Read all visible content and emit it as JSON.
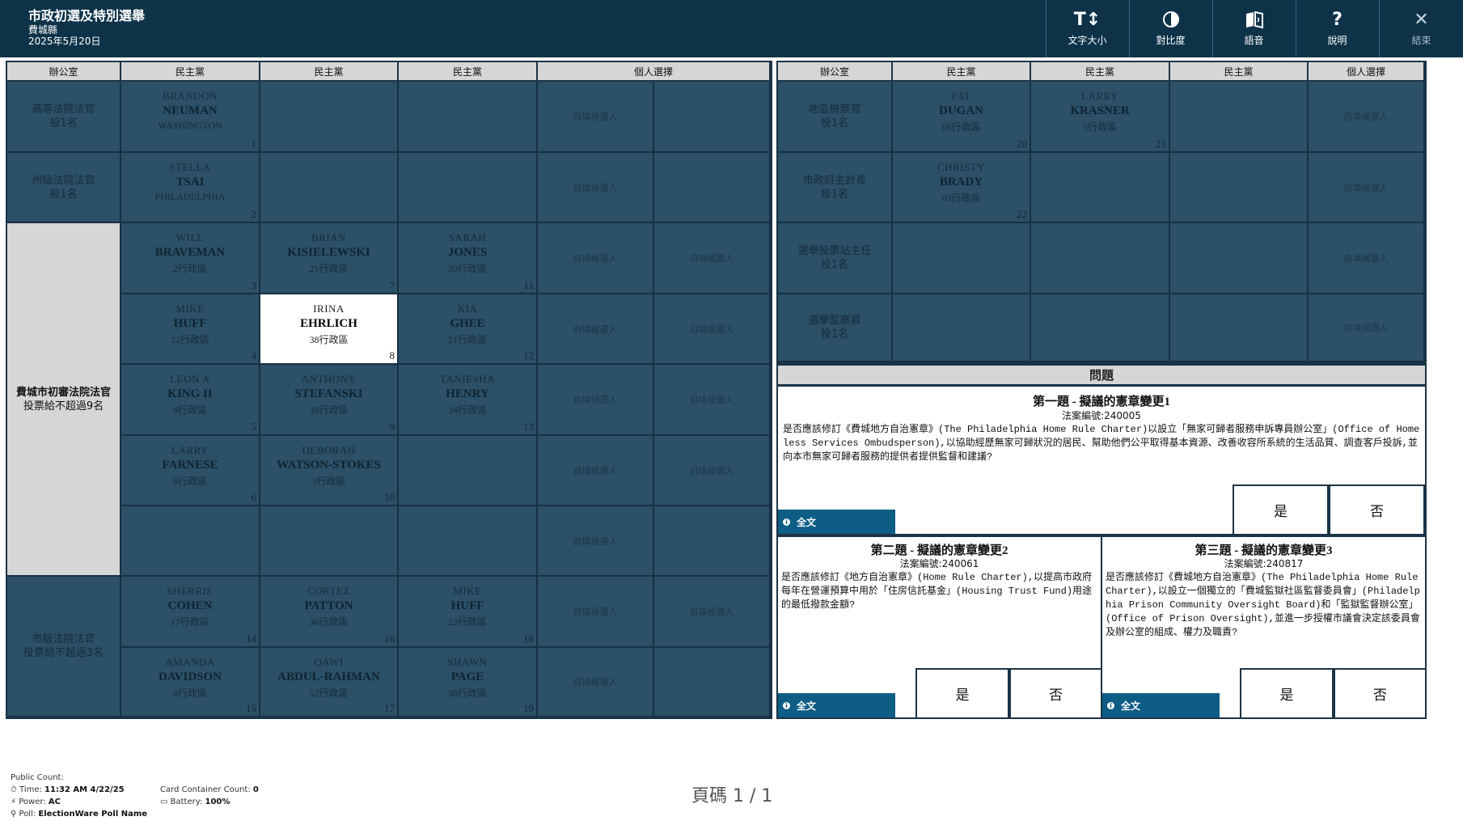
{
  "header": {
    "title": "市政初選及特別選舉",
    "county": "費城縣",
    "date": "2025年5月20日"
  },
  "toolbar": {
    "text_size": "文字大小",
    "contrast": "對比度",
    "audio": "語音",
    "help": "說明",
    "exit": "結束",
    "text_size_glyph": "T↕",
    "help_glyph": "?",
    "exit_glyph": "✕"
  },
  "ballot_headers": {
    "left": [
      "辦公室",
      "民主黨",
      "民主黨",
      "民主黨",
      "個人選擇"
    ],
    "right": [
      "辦公室",
      "民主黨",
      "民主黨",
      "民主黨",
      "個人選擇"
    ]
  },
  "write_in_label": "自填候選人",
  "offices": {
    "superior": {
      "name": "高等法院法官",
      "vote": "投1名"
    },
    "commonwealth": {
      "name": "州級法院法官",
      "vote": "投1名"
    },
    "common_pleas": {
      "name": "費城市初審法院法官",
      "vote": "投票給不超過9名"
    },
    "municipal": {
      "name": "市級法院法官",
      "vote": "投票給不超過3名"
    },
    "da": {
      "name": "地區檢察官",
      "vote": "投1名"
    },
    "controller": {
      "name": "市政府主計長",
      "vote": "投1名"
    },
    "judge_election": {
      "name": "選舉投票站主任",
      "vote": "投1名"
    },
    "inspector": {
      "name": "選舉監察員",
      "vote": "投1名"
    }
  },
  "candidates": {
    "c1": {
      "first": "BRANDON",
      "last": "NEUMAN",
      "district": "WASHINGTON",
      "num": "1"
    },
    "c2": {
      "first": "STELLA",
      "last": "TSAI",
      "district": "PHILADELPHIA",
      "num": "2"
    },
    "c3": {
      "first": "WILL",
      "last": "BRAVEMAN",
      "district": "2行政區",
      "num": "3"
    },
    "c4": {
      "first": "MIKE",
      "last": "HUFF",
      "district": "22行政區",
      "num": "4"
    },
    "c5": {
      "first": "LEON A",
      "last": "KING II",
      "district": "9行政區",
      "num": "5"
    },
    "c6": {
      "first": "LARRY",
      "last": "FARNESE",
      "district": "8行政區",
      "num": "6"
    },
    "c7": {
      "first": "BRIAN",
      "last": "KISIELEWSKI",
      "district": "21行政區",
      "num": "7"
    },
    "c8": {
      "first": "IRINA",
      "last": "EHRLICH",
      "district": "38行政區",
      "num": "8"
    },
    "c9": {
      "first": "ANTHONY",
      "last": "STEFANSKI",
      "district": "39行政區",
      "num": "9"
    },
    "c10": {
      "first": "DEBORAH",
      "last": "WATSON-STOKES",
      "district": "3行政區",
      "num": "10"
    },
    "c11": {
      "first": "SARAH",
      "last": "JONES",
      "district": "30行政區",
      "num": "11"
    },
    "c12": {
      "first": "KIA",
      "last": "GHEE",
      "district": "21行政區",
      "num": "12"
    },
    "c13": {
      "first": "TANIESHA",
      "last": "HENRY",
      "district": "34行政區",
      "num": "13"
    },
    "c14": {
      "first": "SHERRIE",
      "last": "COHEN",
      "district": "17行政區",
      "num": "14"
    },
    "c15": {
      "first": "AMANDA",
      "last": "DAVIDSON",
      "district": "8行政區",
      "num": "15"
    },
    "c16": {
      "first": "CORTEZ",
      "last": "PATTON",
      "district": "36行政區",
      "num": "16"
    },
    "c17": {
      "first": "QAWI",
      "last": "ABDUL-RAHMAN",
      "district": "52行政區",
      "num": "17"
    },
    "c18": {
      "first": "MIKE",
      "last": "HUFF",
      "district": "22行政區",
      "num": "18"
    },
    "c19": {
      "first": "SHAWN",
      "last": "PAGE",
      "district": "38行政區",
      "num": "19"
    },
    "c20": {
      "first": "PAT",
      "last": "DUGAN",
      "district": "66行政區",
      "num": "20"
    },
    "c21": {
      "first": "LARRY",
      "last": "KRASNER",
      "district": "5行政區",
      "num": "21"
    },
    "c22": {
      "first": "CHRISTY",
      "last": "BRADY",
      "district": "63行政區",
      "num": "22"
    }
  },
  "questions": {
    "section": "問題",
    "q1": {
      "title": "第一題 - 擬議的憲章變更1",
      "code": "法案編號:240005",
      "text": "是否應該修訂《費城地方自治憲章》(The Philadelphia Home Rule Charter)以設立「無家可歸者服務申訴專員辦公室」(Office of Homeless Services Ombudsperson),以協助經歷無家可歸狀況的居民、幫助他們公平取得基本資源、改善收容所系統的生活品質、調查客戶投訴,並向本市無家可歸者服務的提供者提供監督和建議?"
    },
    "q2": {
      "title": "第二題 - 擬議的憲章變更2",
      "code": "法案編號:240061",
      "text": "是否應該修訂《地方自治憲章》(Home Rule Charter),以提高市政府每年在營運預算中用於「住房信託基金」(Housing Trust Fund)用途的最低撥款金額?"
    },
    "q3": {
      "title": "第三題 - 擬議的憲章變更3",
      "code": "法案編號:240817",
      "text": "是否應該修訂《費城地方自治憲章》(The Philadelphia Home Rule Charter),以設立一個獨立的「費城監獄社區監督委員會」(Philadelphia Prison Community Oversight Board)和「監獄監督辦公室」(Office of Prison Oversight),並進一步授權市議會決定該委員會及辦公室的組成、權力及職責?"
    },
    "full_text": "全文",
    "yes": "是",
    "no": "否"
  },
  "footer": {
    "public_count": "Public Count:",
    "time_label": "Time:",
    "time": "11:32 AM 4/22/25",
    "power_label": "Power:",
    "power": "AC",
    "poll_label": "Poll:",
    "poll": "ElectionWare Poll Name",
    "card_label": "Card Container Count:",
    "card": "0",
    "battery_label": "Battery:",
    "battery": "100%",
    "page": "頁碼 1 / 1"
  }
}
